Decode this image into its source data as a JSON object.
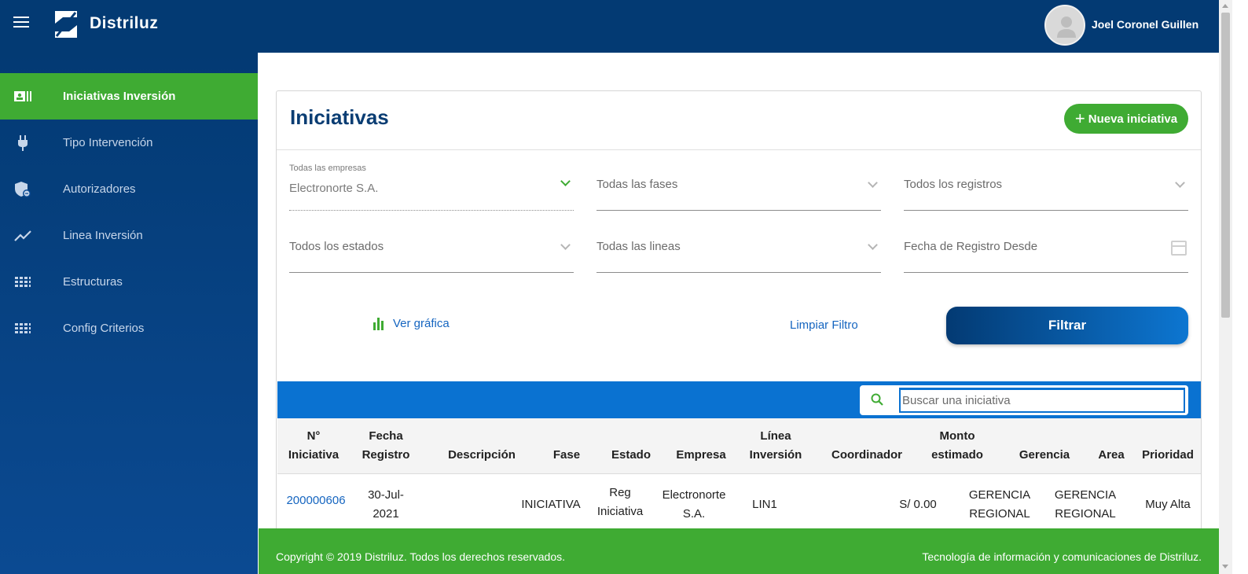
{
  "header": {
    "brand": "Distriluz",
    "user_name": "Joel Coronel Guillen"
  },
  "sidebar": {
    "items": [
      {
        "label": "Iniciativas Inversión",
        "icon": "id-card-icon",
        "active": true
      },
      {
        "label": "Tipo Intervención",
        "icon": "plug-icon",
        "active": false
      },
      {
        "label": "Autorizadores",
        "icon": "shield-lock-icon",
        "active": false
      },
      {
        "label": "Linea Inversión",
        "icon": "trending-line-icon",
        "active": false
      },
      {
        "label": "Estructuras",
        "icon": "grid-icon",
        "active": false
      },
      {
        "label": "Config Criterios",
        "icon": "grid-icon",
        "active": false
      }
    ]
  },
  "main": {
    "title": "Iniciativas",
    "new_button": "Nueva iniciativa",
    "filters": {
      "empresa_label": "Todas las empresas",
      "empresa_value": "Electronorte S.A.",
      "fases": "Todas las fases",
      "registros": "Todos los registros",
      "estados": "Todos los estados",
      "lineas": "Todas las lineas",
      "fecha_desde": "Fecha de Registro Desde"
    },
    "ver_grafica": "Ver gráfica",
    "limpiar_filtro": "Limpiar Filtro",
    "filtrar": "Filtrar",
    "search_placeholder": "Buscar una iniciativa",
    "table": {
      "headers": {
        "numero_1": "N°",
        "numero_2": "Iniciativa",
        "fecha_1": "Fecha",
        "fecha_2": "Registro",
        "descripcion": "Descripción",
        "fase": "Fase",
        "estado": "Estado",
        "empresa": "Empresa",
        "linea_1": "Línea",
        "linea_2": "Inversión",
        "coordinador": "Coordinador",
        "monto_1": "Monto",
        "monto_2": "estimado",
        "gerencia": "Gerencia",
        "area": "Area",
        "prioridad": "Prioridad"
      },
      "rows": [
        {
          "numero": "200000606",
          "fecha_1": "30-Jul-",
          "fecha_2": "2021",
          "descripcion": "",
          "fase": "INICIATIVA",
          "estado_1": "Reg",
          "estado_2": "Iniciativa",
          "empresa_1": "Electronorte",
          "empresa_2": "S.A.",
          "linea": "LIN1",
          "coordinador": "",
          "monto": "S/ 0.00",
          "gerencia_1": "GERENCIA",
          "gerencia_2": "REGIONAL",
          "area_1": "GERENCIA",
          "area_2": "REGIONAL",
          "prioridad": "Muy Alta"
        }
      ]
    }
  },
  "footer": {
    "left": "Copyright © 2019 Distriluz. Todos los derechos reservados.",
    "right": "Tecnología de información y comunicaciones de Distriluz."
  },
  "colors": {
    "header_blue": "#033a73",
    "accent_green": "#3fab33",
    "link_blue": "#1565c0",
    "strip_blue": "#0a72d1"
  }
}
